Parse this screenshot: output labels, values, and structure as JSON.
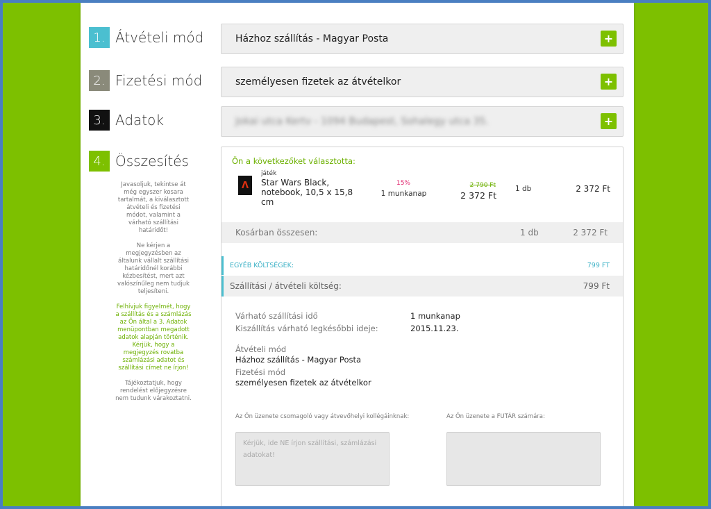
{
  "steps": [
    {
      "num": "1.",
      "label": "Átvételi mód",
      "color": "#4bbfd0"
    },
    {
      "num": "2.",
      "label": "Fizetési mód",
      "color": "#8a8a7a"
    },
    {
      "num": "3.",
      "label": "Adatok",
      "color": "#111111"
    },
    {
      "num": "4.",
      "label": "Összesítés",
      "color": "#7dc000"
    }
  ],
  "side_notes": [
    "Javasoljuk, tekintse át még egyszer kosara tartalmát, a kiválasztott átvételi és fizetési módot, valamint a várható szállítási határidőt!",
    "Ne kérjen a megjegyzésben az általunk vállalt szállítási határidőnél korábbi kézbesítést, mert azt valószínűleg nem tudjuk teljesíteni.",
    "Felhívjuk figyelmét, hogy a szállítás és a számlázás az Ön által a 3. Adatok menüpontban megadott adatok alapján történik. Kérjük, hogy a megjegyzés rovatba számlázási adatot és szállítási címet ne írjon!",
    "Tájékoztatjuk, hogy rendelést előjegyzésre nem tudunk várakoztatni."
  ],
  "selections": {
    "delivery": "Házhoz szállítás - Magyar Posta",
    "payment": "személyesen fizetek az átvételkor",
    "address": "Jokai utca Kertv - 1094 Budapest, Sohalegy utca 35."
  },
  "plus_label": "+",
  "summary": {
    "title": "Ön a következőket választotta:",
    "product": {
      "category": "játék",
      "name": "Star Wars Black, notebook, 10,5 x 15,8 cm",
      "discount": "15%",
      "delivery": "1 munkanap",
      "old_price": "2 790 Ft",
      "price": "2 372 Ft",
      "qty": "1 db",
      "total": "2 372 Ft",
      "image_icon": "book-cover-icon"
    },
    "basket": {
      "label": "Kosárban összesen:",
      "qty": "1 db",
      "sum": "2 372 Ft"
    },
    "other_costs": {
      "label": "EGYÉB KÖLTSÉGEK:",
      "value": "799 FT"
    },
    "shipping_cost": {
      "label": "Szállítási / átvételi költség:",
      "value": "799 Ft"
    },
    "expected_label": "Várható szállítási idő",
    "expected_value": "1 munkanap",
    "earliest_label": "Kiszállítás várható legkésőbbi ideje:",
    "earliest_value": "2015.11.23.",
    "delivery_mode_label": "Átvételi mód",
    "delivery_mode_value": "Házhoz szállítás - Magyar Posta",
    "payment_mode_label": "Fizetési mód",
    "payment_mode_value": "személyesen fizetek az átvételkor",
    "msg_packer_label": "Az Ön üzenete csomagoló vagy átvevőhelyi kollégáinknak:",
    "msg_packer_placeholder": "Kérjük, ide NE írjon szállítási, számlázási adatokat!",
    "msg_courier_label": "Az Ön üzenete a FUTÁR számára:",
    "msg_courier_placeholder": ""
  }
}
